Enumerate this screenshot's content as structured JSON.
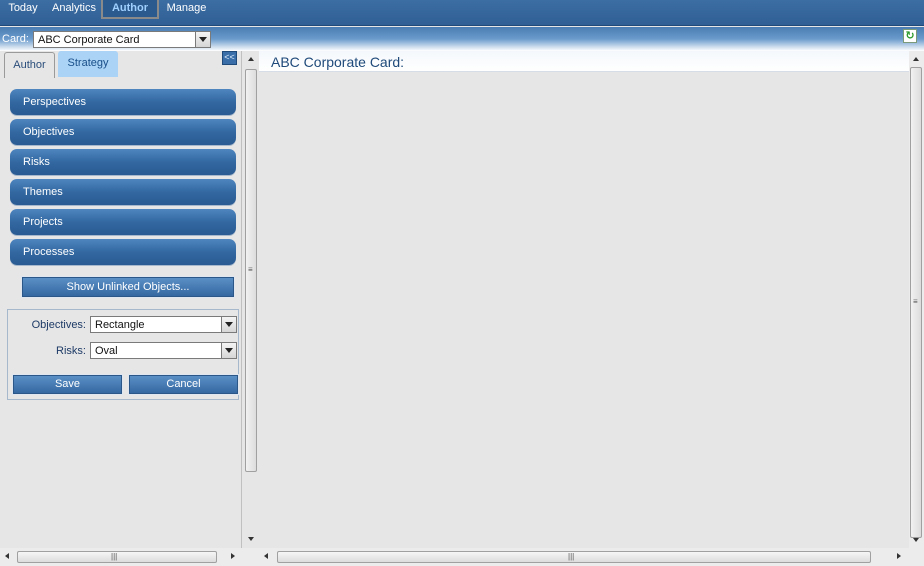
{
  "topnav": {
    "items": [
      {
        "label": "Today"
      },
      {
        "label": "Analytics"
      },
      {
        "label": "Author",
        "active": true
      },
      {
        "label": "Manage"
      }
    ]
  },
  "cardbar": {
    "label": "Card:",
    "selected": "ABC Corporate Card",
    "refresh_icon": "refresh-icon"
  },
  "left_panel": {
    "tabs": [
      {
        "label": "Author"
      },
      {
        "label": "Strategy",
        "active": true
      }
    ],
    "collapse_label": "<<",
    "buttons": [
      {
        "label": "Perspectives"
      },
      {
        "label": "Objectives"
      },
      {
        "label": "Risks"
      },
      {
        "label": "Themes"
      },
      {
        "label": "Projects"
      },
      {
        "label": "Processes"
      }
    ],
    "show_unlinked_label": "Show Unlinked Objects...",
    "settings": {
      "objectives_label": "Objectives:",
      "objectives_value": "Rectangle",
      "risks_label": "Risks:",
      "risks_value": "Oval"
    },
    "save_label": "Save",
    "cancel_label": "Cancel"
  },
  "main": {
    "title": "ABC Corporate Card:"
  },
  "colors": {
    "nav_bg": "#2f5f95",
    "button_blue": "#3368a1",
    "tab_active": "#aad3f5",
    "panel_bg": "#e6e6e6"
  }
}
